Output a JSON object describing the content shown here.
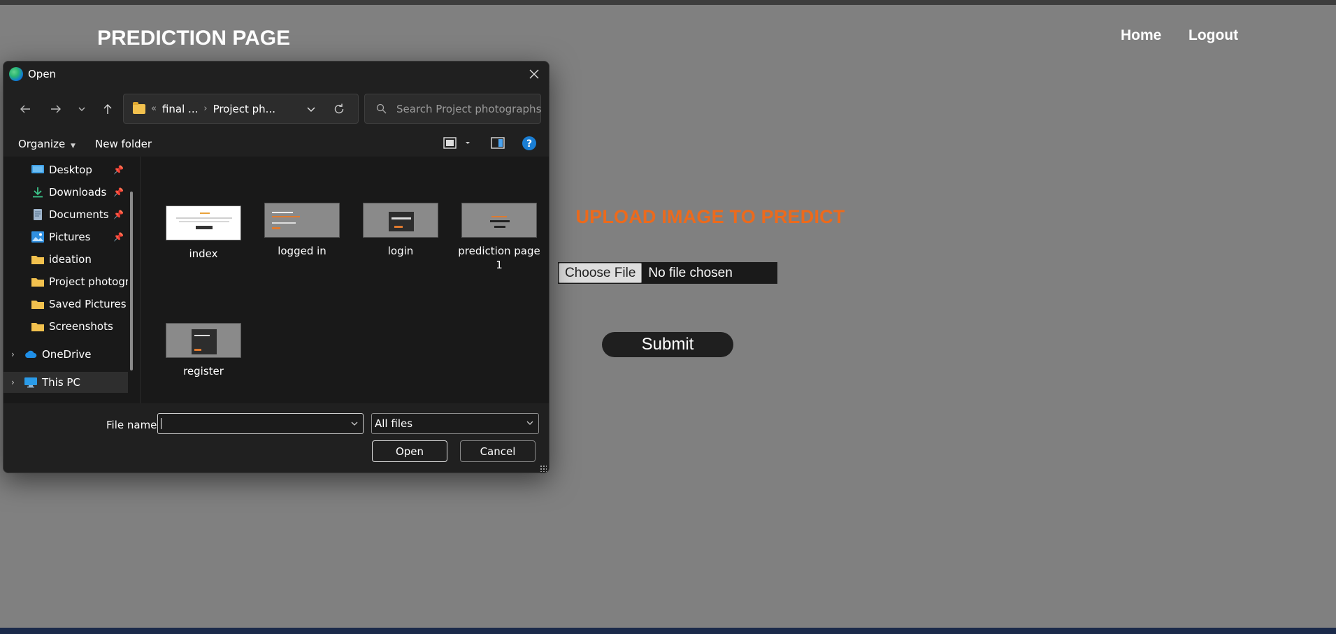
{
  "webpage": {
    "title": "PREDICTION PAGE",
    "nav": {
      "home": "Home",
      "logout": "Logout"
    },
    "heading": "UPLOAD IMAGE TO PREDICT",
    "file_input": {
      "button": "Choose File",
      "status": "No file chosen"
    },
    "submit": "Submit",
    "accent_color": "#ec6a1c"
  },
  "dialog": {
    "title": "Open",
    "address": {
      "prefix": "«",
      "crumbs": [
        "final ...",
        "Project ph..."
      ]
    },
    "search_placeholder": "Search Project photographs",
    "toolbar": {
      "organize": "Organize",
      "new_folder": "New folder"
    },
    "sidebar": [
      {
        "label": "Desktop",
        "icon": "desktop-icon",
        "pinned": true
      },
      {
        "label": "Downloads",
        "icon": "download-icon",
        "pinned": true
      },
      {
        "label": "Documents",
        "icon": "document-icon",
        "pinned": true
      },
      {
        "label": "Pictures",
        "icon": "pictures-icon",
        "pinned": true
      },
      {
        "label": "ideation",
        "icon": "folder-icon",
        "pinned": false
      },
      {
        "label": "Project photographs",
        "icon": "folder-icon",
        "pinned": false
      },
      {
        "label": "Saved Pictures",
        "icon": "folder-icon",
        "pinned": false
      },
      {
        "label": "Screenshots",
        "icon": "folder-icon",
        "pinned": false
      },
      {
        "label": "OneDrive",
        "icon": "cloud-icon",
        "pinned": false
      },
      {
        "label": "This PC",
        "icon": "computer-icon",
        "pinned": false,
        "selected": true
      }
    ],
    "files": [
      {
        "name": "index"
      },
      {
        "name": "logged in"
      },
      {
        "name": "login"
      },
      {
        "name": "prediction page 1"
      },
      {
        "name": "register"
      }
    ],
    "footer": {
      "file_name_label": "File name:",
      "file_name_value": "",
      "file_type": "All files",
      "open": "Open",
      "cancel": "Cancel"
    }
  }
}
